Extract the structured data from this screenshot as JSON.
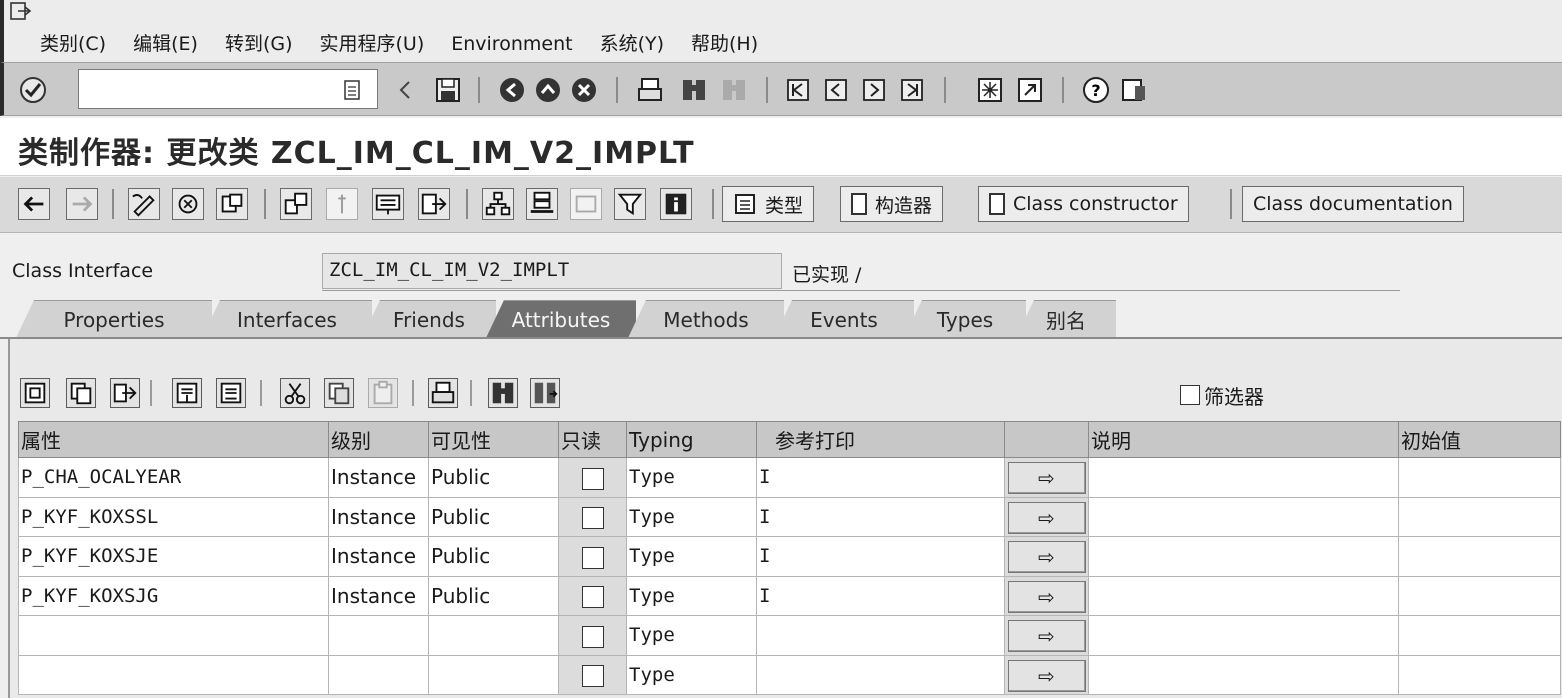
{
  "menu": [
    "类别(C)",
    "编辑(E)",
    "转到(G)",
    "实用程序(U)",
    "Environment",
    "系统(Y)",
    "帮助(H)"
  ],
  "screen_title": "类制作器: 更改类 ZCL_IM_CL_IM_V2_IMPLT",
  "app_toolbar": {
    "type_button": "类型",
    "constructor_button": "构造器",
    "class_constructor_button": "Class constructor",
    "class_documentation_button": "Class documentation"
  },
  "class_interface": {
    "label": "Class Interface",
    "value": "ZCL_IM_CL_IM_V2_IMPLT",
    "status": "已实现 /"
  },
  "tabs": [
    {
      "label": "Properties",
      "active": false
    },
    {
      "label": "Interfaces",
      "active": false
    },
    {
      "label": "Friends",
      "active": false
    },
    {
      "label": "Attributes",
      "active": true
    },
    {
      "label": "Methods",
      "active": false
    },
    {
      "label": "Events",
      "active": false
    },
    {
      "label": "Types",
      "active": false
    },
    {
      "label": "别名",
      "active": false
    }
  ],
  "filter": {
    "label": "筛选器",
    "checked": false
  },
  "grid": {
    "columns": [
      "属性",
      "级别",
      "可见性",
      "只读",
      "Typing",
      "参考打印",
      "",
      "说明",
      "初始值"
    ],
    "rows": [
      {
        "attribute": "P_CHA_OCALYEAR",
        "level": "Instance",
        "visibility": "Public",
        "readonly": false,
        "typing": "Type",
        "ref_type": "I",
        "description": "",
        "initial": ""
      },
      {
        "attribute": "P_KYF_KOXSSL",
        "level": "Instance",
        "visibility": "Public",
        "readonly": false,
        "typing": "Type",
        "ref_type": "I",
        "description": "",
        "initial": ""
      },
      {
        "attribute": "P_KYF_KOXSJE",
        "level": "Instance",
        "visibility": "Public",
        "readonly": false,
        "typing": "Type",
        "ref_type": "I",
        "description": "",
        "initial": ""
      },
      {
        "attribute": "P_KYF_KOXSJG",
        "level": "Instance",
        "visibility": "Public",
        "readonly": false,
        "typing": "Type",
        "ref_type": "I",
        "description": "",
        "initial": ""
      },
      {
        "attribute": "",
        "level": "",
        "visibility": "",
        "readonly": false,
        "typing": "Type",
        "ref_type": "",
        "description": "",
        "initial": ""
      },
      {
        "attribute": "",
        "level": "",
        "visibility": "",
        "readonly": false,
        "typing": "Type",
        "ref_type": "",
        "description": "",
        "initial": ""
      }
    ]
  },
  "icons": {
    "std_toolbar": [
      "enter-icon",
      "back-icon",
      "exit-icon",
      "cancel-icon",
      "print-icon",
      "find-icon",
      "find-next-icon",
      "first-page-icon",
      "previous-page-icon",
      "next-page-icon",
      "last-page-icon",
      "new-session-icon",
      "shortcut-icon",
      "help-icon",
      "layout-icon"
    ],
    "arrow_button": "right-arrow-icon"
  }
}
